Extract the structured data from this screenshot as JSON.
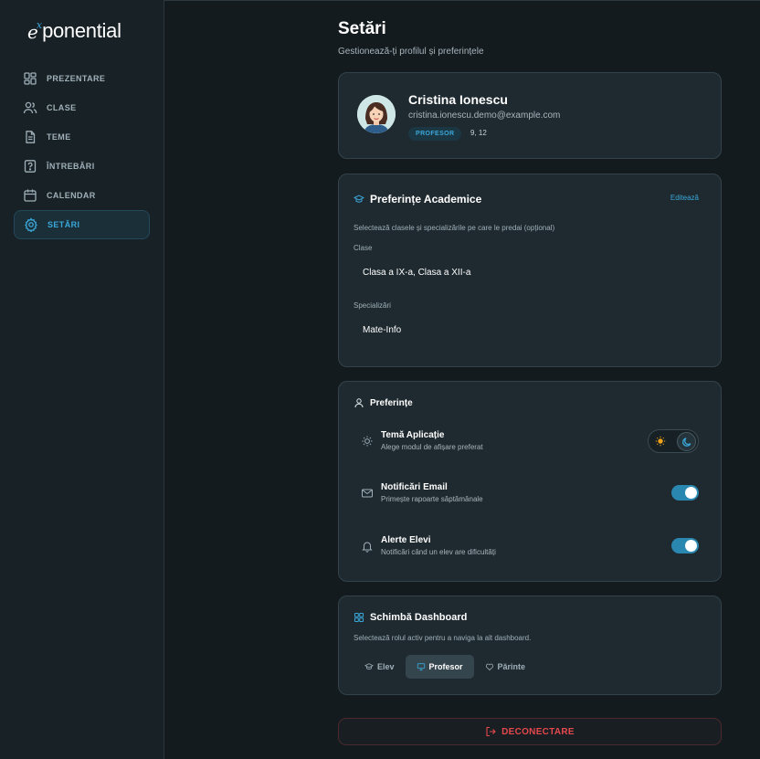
{
  "brand": {
    "logo_e": "e",
    "logo_x": "x",
    "logo_rest": "ponential"
  },
  "sidebar": {
    "items": [
      {
        "label": "PREZENTARE",
        "icon": "dashboard-icon"
      },
      {
        "label": "CLASE",
        "icon": "users-icon"
      },
      {
        "label": "TEME",
        "icon": "file-icon"
      },
      {
        "label": "ÎNTREBĂRI",
        "icon": "question-icon"
      },
      {
        "label": "CALENDAR",
        "icon": "calendar-icon"
      },
      {
        "label": "SETĂRI",
        "icon": "gear-icon",
        "active": true
      }
    ]
  },
  "page": {
    "title": "Setări",
    "subtitle": "Gestionează-ți profilul și preferințele"
  },
  "profile": {
    "name": "Cristina Ionescu",
    "email": "cristina.ionescu.demo@example.com",
    "role_badge": "PROFESOR",
    "classes_short": "9, 12"
  },
  "academic": {
    "title": "Preferințe Academice",
    "edit_label": "Editează",
    "description": "Selectează clasele și specializările pe care le predai (opțional)",
    "classes_label": "Clase",
    "classes_value": "Clasa a IX-a, Clasa a XII-a",
    "specializations_label": "Specializări",
    "specializations_value": "Mate-Info"
  },
  "preferences": {
    "title": "Preferințe",
    "theme": {
      "label": "Temă Aplicație",
      "description": "Alege modul de afișare preferat",
      "selected": "dark"
    },
    "email_notifications": {
      "label": "Notificări Email",
      "description": "Primește rapoarte săptămânale",
      "enabled": true
    },
    "student_alerts": {
      "label": "Alerte Elevi",
      "description": "Notificări când un elev are dificultăți",
      "enabled": true
    }
  },
  "dashboard_switch": {
    "title": "Schimbă Dashboard",
    "description": "Selectează rolul activ pentru a naviga la alt dashboard.",
    "options": [
      {
        "label": "Elev",
        "active": false
      },
      {
        "label": "Profesor",
        "active": true
      },
      {
        "label": "Părinte",
        "active": false
      }
    ]
  },
  "logout": {
    "label": "DECONECTARE"
  },
  "colors": {
    "accent": "#3aa7d9",
    "danger": "#e5484d",
    "background": "#141b1f",
    "card": "#1f2a30"
  }
}
